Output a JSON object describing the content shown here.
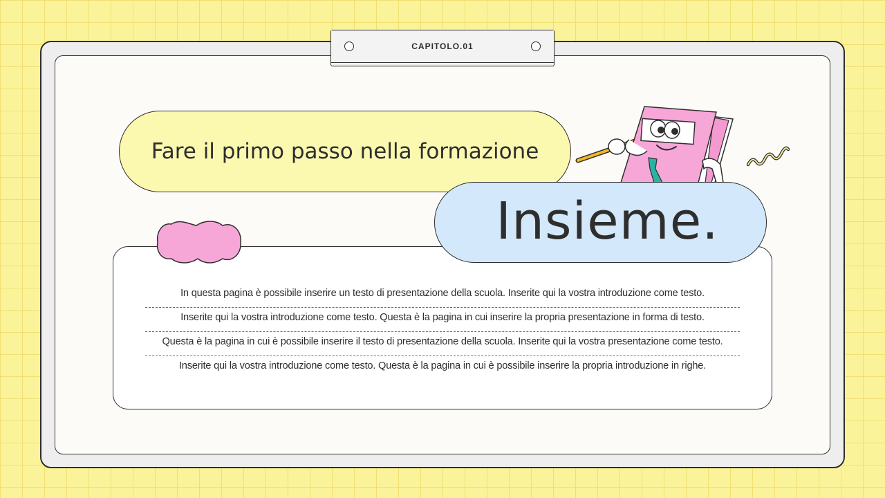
{
  "tab": {
    "label": "CAPITOLO.01"
  },
  "subtitle": "Fare il primo passo nella formazione",
  "title": "Insieme.",
  "lines": [
    "In questa pagina è possibile inserire un testo di presentazione della scuola. Inserite qui la vostra introduzione come testo.",
    "Inserite qui la vostra introduzione come testo. Questa è la pagina in cui inserire la propria presentazione in forma di testo.",
    "Questa è la pagina in cui è possibile inserire il testo di presentazione della scuola. Inserite qui la vostra presentazione come testo.",
    "Inserite qui la vostra introduzione come testo. Questa è la pagina in cui è possibile inserire la propria introduzione in righe."
  ],
  "colors": {
    "background": "#fbf39a",
    "yellow_pill": "#fbf8b0",
    "blue_pill": "#d3e9fb",
    "pink": "#f7a6d8",
    "outline": "#2e2e2e"
  },
  "icons": [
    "book-mascot-illustration",
    "pink-blob-shape",
    "squiggle-decoration"
  ]
}
